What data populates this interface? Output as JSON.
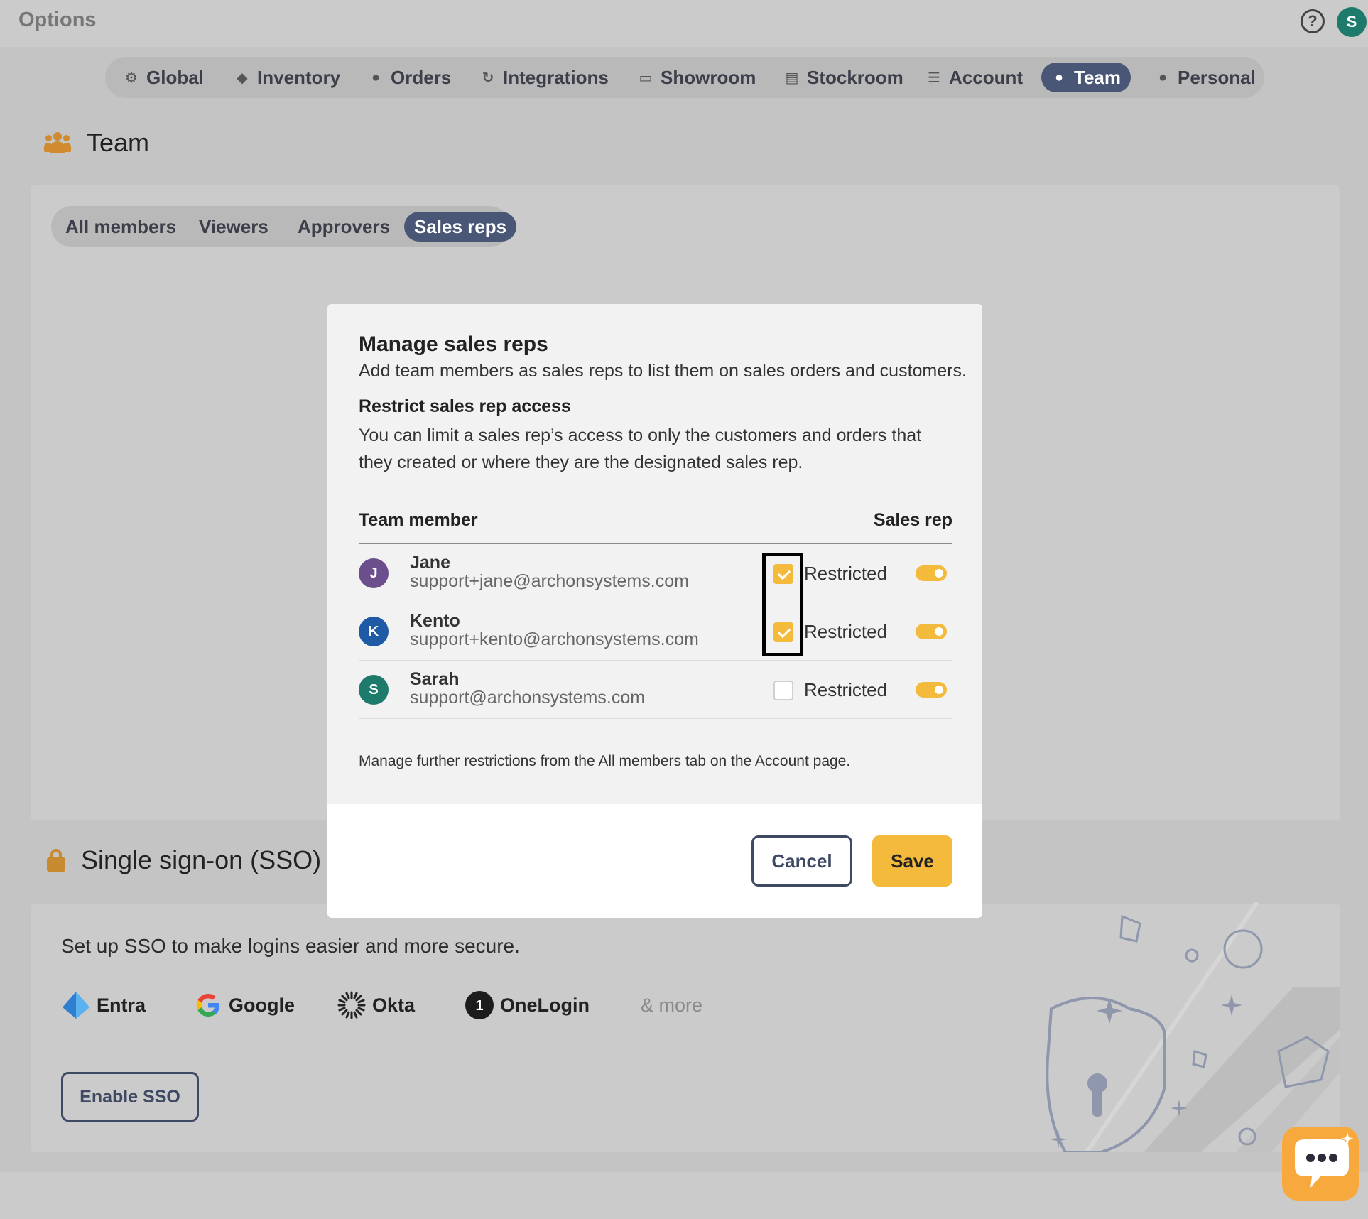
{
  "app": {
    "title": "Options",
    "user_initial": "S",
    "help_glyph": "?"
  },
  "nav": {
    "tabs": [
      {
        "label": "Global",
        "icon": "gear-icon"
      },
      {
        "label": "Inventory",
        "icon": "box-icon"
      },
      {
        "label": "Orders",
        "icon": "dollar-icon"
      },
      {
        "label": "Integrations",
        "icon": "sync-icon"
      },
      {
        "label": "Showroom",
        "icon": "laptop-icon"
      },
      {
        "label": "Stockroom",
        "icon": "shelf-icon"
      },
      {
        "label": "Account",
        "icon": "sliders-icon"
      },
      {
        "label": "Team",
        "icon": "users-icon"
      },
      {
        "label": "Personal",
        "icon": "person-icon"
      }
    ],
    "active": "Team"
  },
  "team": {
    "heading": "Team",
    "subtabs": [
      {
        "label": "All members"
      },
      {
        "label": "Viewers"
      },
      {
        "label": "Approvers"
      },
      {
        "label": "Sales reps"
      }
    ],
    "active_subtab": "Sales reps"
  },
  "sso": {
    "heading": "Single sign-on (SSO)",
    "description": "Set up SSO to make logins easier and more secure.",
    "providers": [
      {
        "label": "Entra",
        "icon": "entra-logo-icon"
      },
      {
        "label": "Google",
        "icon": "google-logo-icon"
      },
      {
        "label": "Okta",
        "icon": "okta-logo-icon"
      },
      {
        "label": "OneLogin",
        "icon": "onelogin-logo-icon"
      }
    ],
    "more_label": "& more",
    "button_label": "Enable SSO"
  },
  "modal": {
    "title": "Manage sales reps",
    "subtitle": "Add team members as sales reps to list them on sales orders and customers.",
    "restrict_heading": "Restrict sales rep access",
    "restrict_text": "You can limit a sales rep’s access to only the customers and orders that they created or where they are the designated sales rep.",
    "col_member": "Team member",
    "col_sales_rep": "Sales rep",
    "members": [
      {
        "initial": "J",
        "name": "Jane",
        "email": "support+jane@archonsystems.com",
        "restricted": true,
        "restricted_label": "Restricted",
        "sales_rep": true,
        "color": "#6b4e8c"
      },
      {
        "initial": "K",
        "name": "Kento",
        "email": "support+kento@archonsystems.com",
        "restricted": true,
        "restricted_label": "Restricted",
        "sales_rep": true,
        "color": "#1f5aa6"
      },
      {
        "initial": "S",
        "name": "Sarah",
        "email": "support@archonsystems.com",
        "restricted": false,
        "restricted_label": "Restricted",
        "sales_rep": true,
        "color": "#1e7a6a"
      }
    ],
    "note": "Manage further restrictions from the All members tab on the Account page.",
    "cancel_label": "Cancel",
    "save_label": "Save"
  },
  "colors": {
    "accent": "#f3ba3c",
    "nav_active": "#4a5675",
    "primary_text": "#3e4a63"
  }
}
